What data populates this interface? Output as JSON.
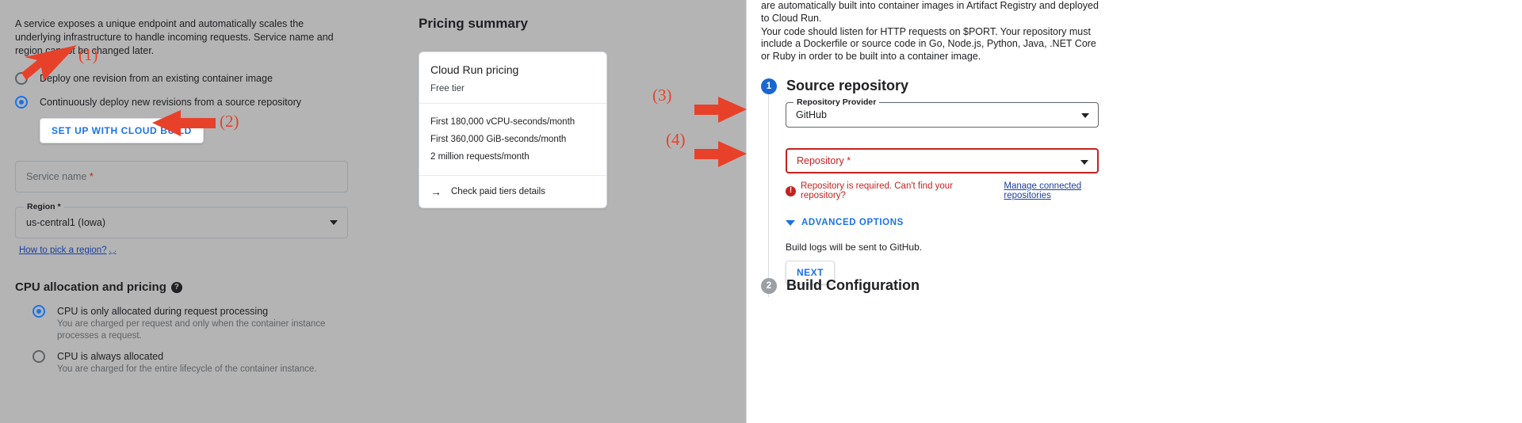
{
  "left_panel": {
    "intro": "A service exposes a unique endpoint and automatically scales the underlying infrastructure to handle incoming requests. Service name and region cannot be changed later.",
    "deploy_options": [
      {
        "label": "Deploy one revision from an existing container image",
        "selected": false
      },
      {
        "label": "Continuously deploy new revisions from a source repository",
        "selected": true
      }
    ],
    "cloud_build_button": "SET UP WITH CLOUD BUILD",
    "service_name_field": {
      "placeholder": "Service name",
      "required_marker": "*",
      "value": ""
    },
    "region_field": {
      "legend": "Region *",
      "value": "us-central1 (Iowa)"
    },
    "region_help_link": "How to pick a region?",
    "cpu_section": {
      "title": "CPU allocation and pricing",
      "options": [
        {
          "label": "CPU is only allocated during request processing",
          "description": "You are charged per request and only when the container instance processes a request.",
          "selected": true
        },
        {
          "label": "CPU is always allocated",
          "description": "You are charged for the entire lifecycle of the container instance.",
          "selected": false
        }
      ]
    }
  },
  "pricing_summary": {
    "title": "Pricing summary",
    "card": {
      "title": "Cloud Run pricing",
      "subtitle": "Free tier",
      "lines": [
        "First 180,000 vCPU-seconds/month",
        "First 360,000 GiB-seconds/month",
        "2 million requests/month"
      ],
      "footer_link": "Check paid tiers details"
    }
  },
  "right_panel": {
    "intro_lines": [
      "are automatically built into container images in Artifact Registry and deployed to Cloud Run.",
      "Your code should listen for HTTP requests on $PORT. Your repository must include a Dockerfile or source code in Go, Node.js, Python, Java, .NET Core or Ruby in order to be built into a container image."
    ],
    "step1": {
      "number": "1",
      "title": "Source repository",
      "provider_field": {
        "legend": "Repository Provider",
        "value": "GitHub"
      },
      "repository_field": {
        "placeholder": "Repository *",
        "value": ""
      },
      "error_text": "Repository is required. Can't find your repository?",
      "error_link": "Manage connected repositories",
      "advanced_options": "ADVANCED OPTIONS",
      "build_logs_note": "Build logs will be sent to GitHub.",
      "next_button": "NEXT"
    },
    "step2": {
      "number": "2",
      "title": "Build Configuration"
    }
  },
  "annotations": [
    {
      "id": "1",
      "label": "(1)"
    },
    {
      "id": "2",
      "label": "(2)"
    },
    {
      "id": "3",
      "label": "(3)"
    },
    {
      "id": "4",
      "label": "(4)"
    }
  ],
  "colors": {
    "accent_blue": "#1a73e8",
    "error_red": "#c5221f",
    "annotation_red": "#e8412a",
    "backdrop": "#b4b4b4"
  }
}
